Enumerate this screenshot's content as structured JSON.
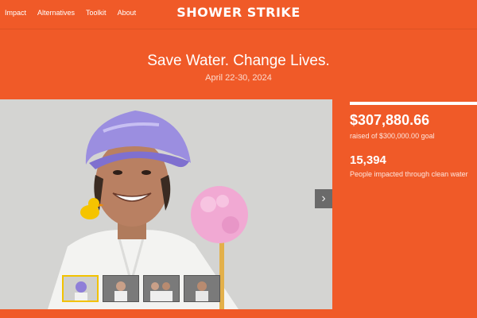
{
  "nav": {
    "links": [
      "Impact",
      "Alternatives",
      "Toolkit",
      "About"
    ],
    "logo": "SHOWER STRIKE"
  },
  "hero": {
    "title": "Save Water. Change Lives.",
    "date": "April 22-30, 2024"
  },
  "carousel": {
    "thumbnail_count": 4,
    "active_index": 0,
    "next_icon": "chevron-right-icon"
  },
  "stats": {
    "raised": "$307,880.66",
    "goal_text": "raised of $300,000.00 goal",
    "progress_fraction": 1.0,
    "people_count": "15,394",
    "people_label": "People impacted through clean water"
  },
  "colors": {
    "brand": "#f05a28",
    "thumb_active_border": "#f2c200"
  }
}
